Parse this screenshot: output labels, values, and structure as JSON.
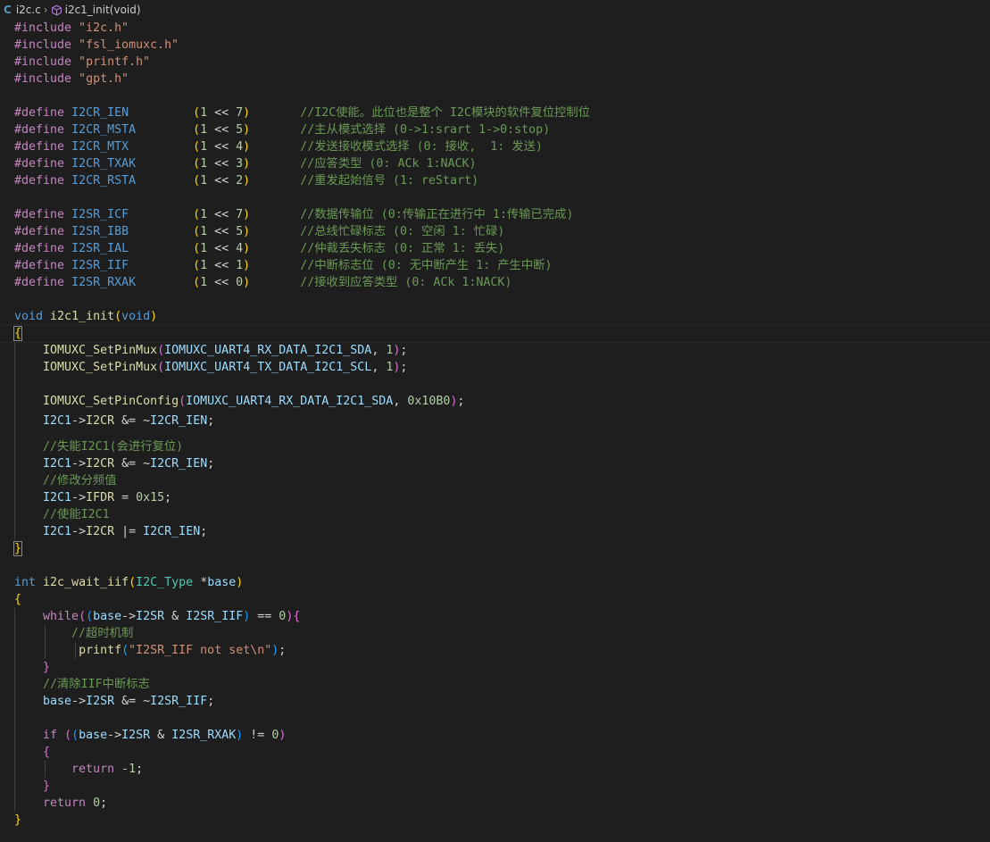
{
  "breadcrumb": {
    "file_icon": "C",
    "file": "i2c.c",
    "symbol": "i2c1_init(void)"
  },
  "includes": [
    {
      "directive": "#include",
      "file": "\"i2c.h\""
    },
    {
      "directive": "#include",
      "file": "\"fsl_iomuxc.h\""
    },
    {
      "directive": "#include",
      "file": "\"printf.h\""
    },
    {
      "directive": "#include",
      "file": "\"gpt.h\""
    }
  ],
  "defines_cr": [
    {
      "name": "I2CR_IEN",
      "shift": "7",
      "comment": "//I2C使能。此位也是整个 I2C模块的软件复位控制位"
    },
    {
      "name": "I2CR_MSTA",
      "shift": "5",
      "comment": "//主从模式选择 (0->1:srart 1->0:stop)"
    },
    {
      "name": "I2CR_MTX",
      "shift": "4",
      "comment": "//发送接收模式选择 (0: 接收,  1: 发送)"
    },
    {
      "name": "I2CR_TXAK",
      "shift": "3",
      "comment": "//应答类型 (0: ACk 1:NACK)"
    },
    {
      "name": "I2CR_RSTA",
      "shift": "2",
      "comment": "//重发起始信号 (1: reStart)"
    }
  ],
  "defines_sr": [
    {
      "name": "I2SR_ICF",
      "shift": "7",
      "comment": "//数据传输位 (0:传输正在进行中 1:传输已完成)"
    },
    {
      "name": "I2SR_IBB",
      "shift": "5",
      "comment": "//总线忙碌标志 (0: 空闲 1: 忙碌)"
    },
    {
      "name": "I2SR_IAL",
      "shift": "4",
      "comment": "//仲裁丢失标志 (0: 正常 1: 丢失)"
    },
    {
      "name": "I2SR_IIF",
      "shift": "1",
      "comment": "//中断标志位 (0: 无中断产生 1: 产生中断)"
    },
    {
      "name": "I2SR_RXAK",
      "shift": "0",
      "comment": "//接收到应答类型 (0: ACk 1:NACK)"
    }
  ],
  "code": {
    "define_kw": "#define",
    "one": "1",
    "shl": "<<",
    "void": "void",
    "int": "int",
    "init_fn": "i2c1_init",
    "pinmux_fn": "IOMUXC_SetPinMux",
    "pinconfig_fn": "IOMUXC_SetPinConfig",
    "rx_pin": "IOMUXC_UART4_RX_DATA_I2C1_SDA",
    "tx_pin": "IOMUXC_UART4_TX_DATA_I2C1_SCL",
    "one_arg": "1",
    "config_val": "0x10B0",
    "i2c1": "I2C1",
    "arrow": "->",
    "i2cr": "I2CR",
    "ifdr": "IFDR",
    "and_not": "&= ~",
    "or_eq": "|=",
    "ien": "I2CR_IEN",
    "ifdr_val": "0x15",
    "cmt_disable": "//失能I2C1(会进行复位)",
    "cmt_divider": "//修改分频值",
    "cmt_enable": "//使能I2C1",
    "wait_fn": "i2c_wait_iif",
    "type_name": "I2C_Type",
    "base": "base",
    "i2sr": "I2SR",
    "iif": "I2SR_IIF",
    "rxak": "I2SR_RXAK",
    "while_kw": "while",
    "if_kw": "if",
    "return_kw": "return",
    "zero": "0",
    "neg_one": "-1",
    "cmt_timeout": "//超时机制",
    "printf_fn": "printf",
    "printf_str": "\"I2SR_IIF not set\\n\"",
    "cmt_clear": "//清除IIF中断标志"
  }
}
